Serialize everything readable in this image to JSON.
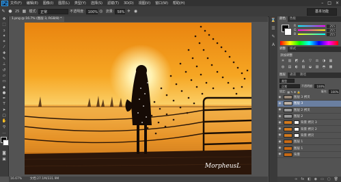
{
  "app": {
    "logo": "Ps"
  },
  "menu": [
    "文件(F)",
    "编辑(E)",
    "图像(I)",
    "图层(L)",
    "类型(Y)",
    "选择(S)",
    "滤镜(T)",
    "3D(D)",
    "视图(V)",
    "窗口(W)",
    "帮助(H)"
  ],
  "window_controls": [
    "–",
    "□",
    "×"
  ],
  "options": {
    "size": "25",
    "mode_label": "模式:",
    "mode_value": "正常",
    "opacity_label": "不透明度:",
    "opacity_value": "100%",
    "flow_label": "流量:",
    "flow_value": "58%",
    "workspace": "基本功能"
  },
  "document": {
    "tab": "1.png @ 16.7% (图层 3, RGB/8) *",
    "watermark": "MorpheusL"
  },
  "status": {
    "zoom": "16.67%",
    "doc": "文档:27.1M/331.9M"
  },
  "color_panel": {
    "tabs": [
      "颜色",
      "色板"
    ],
    "sliders": [
      {
        "label": "R",
        "value": "255"
      },
      {
        "label": "G",
        "value": "255"
      },
      {
        "label": "B",
        "value": "255"
      }
    ]
  },
  "adjust_panel": {
    "tabs": [
      "调整",
      "样式"
    ],
    "title": "添加调整",
    "icons": [
      "☀",
      "▥",
      "◩",
      "◭",
      "▽",
      "⚖",
      "◑",
      "▦",
      "◍",
      "▤",
      "◐",
      "▧",
      "◒",
      "▨",
      "◓",
      "▩"
    ]
  },
  "layers_panel": {
    "tabs": [
      "图层",
      "通道",
      "路径"
    ],
    "kind": "类型",
    "blend": "正常",
    "opacity_label": "不透明度:",
    "opacity_value": "100%",
    "lock_label": "锁定:",
    "fill_label": "填充:",
    "fill_value": "100%",
    "layers": [
      {
        "name": "图层 3 拷贝",
        "thumb": "#9a8a7a",
        "mask": false,
        "selected": false
      },
      {
        "name": "图层 3",
        "thumb": "#bfb3a6",
        "mask": false,
        "selected": true
      },
      {
        "name": "图层 2 拷贝",
        "thumb": "#999999",
        "mask": false,
        "selected": false
      },
      {
        "name": "图层 2",
        "thumb": "#999999",
        "mask": false,
        "selected": false
      },
      {
        "name": "背景 拷贝 3",
        "thumb": "#d27a1e",
        "mask": true,
        "selected": false
      },
      {
        "name": "背景 拷贝 2",
        "thumb": "#d27a1e",
        "mask": true,
        "selected": false
      },
      {
        "name": "背景 拷贝",
        "thumb": "#d27a1e",
        "mask": true,
        "selected": false
      },
      {
        "name": "图层 1",
        "thumb": "#c86a15",
        "mask": false,
        "selected": false
      },
      {
        "name": "图层 1",
        "thumb": "#c86a15",
        "mask": false,
        "selected": false
      },
      {
        "name": "背景",
        "thumb": "#c86a15",
        "mask": false,
        "selected": false
      }
    ],
    "bottom_icons": [
      "∞",
      "fx",
      "◧",
      "◉",
      "▭",
      "▢",
      "🗑"
    ]
  }
}
